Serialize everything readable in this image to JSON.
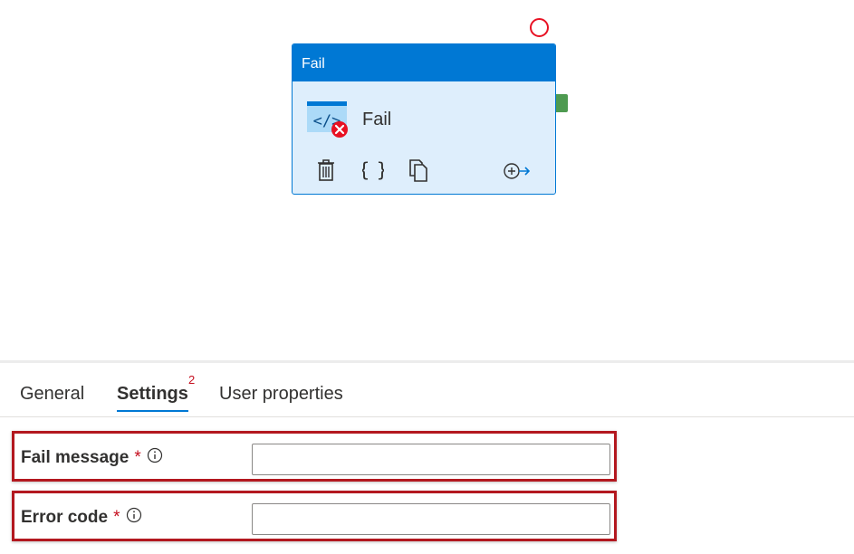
{
  "canvas": {
    "activity": {
      "header_title": "Fail",
      "name": "Fail",
      "icon": "code-icon-with-error-badge",
      "actions": [
        "delete-icon",
        "code-braces-icon",
        "copy-icon",
        "add-output-icon"
      ],
      "status_indicator": "red-circle",
      "colors": {
        "header": "#0078d4",
        "body": "#deeefc",
        "status": "#e81123",
        "output_port": "#4e9a50"
      }
    }
  },
  "tabs": [
    {
      "label": "General",
      "active": false
    },
    {
      "label": "Settings",
      "active": true,
      "badge": "2"
    },
    {
      "label": "User properties",
      "active": false
    }
  ],
  "settings": {
    "fail_message": {
      "label": "Fail message",
      "required_mark": "*",
      "value": "",
      "info_icon": "info-icon"
    },
    "error_code": {
      "label": "Error code",
      "required_mark": "*",
      "value": "",
      "info_icon": "info-icon"
    }
  },
  "colors": {
    "accent": "#0078d4",
    "required": "#c50f1f",
    "highlight_border": "#b3181f"
  }
}
